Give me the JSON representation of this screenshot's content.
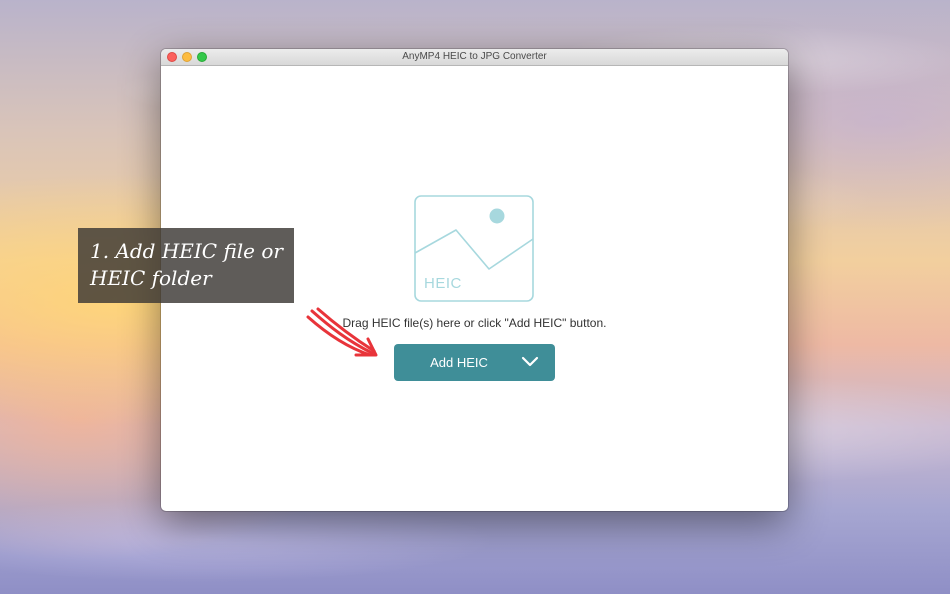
{
  "window": {
    "title": "AnyMP4 HEIC to JPG Converter"
  },
  "placeholder": {
    "icon": "image-icon",
    "label": "HEIC"
  },
  "drop_hint": "Drag HEIC file(s) here or click \"Add HEIC\" button.",
  "add_button": {
    "label": "Add HEIC",
    "dropdown_icon": "chevron-down-icon"
  },
  "callout": {
    "line1": "1. Add HEIC file or",
    "line2": "HEIC folder"
  },
  "colors": {
    "accent": "#3f8e98",
    "placeholder": "#a7d8de",
    "arrow": "#e8343a",
    "callout_bg": "#3c3834"
  }
}
